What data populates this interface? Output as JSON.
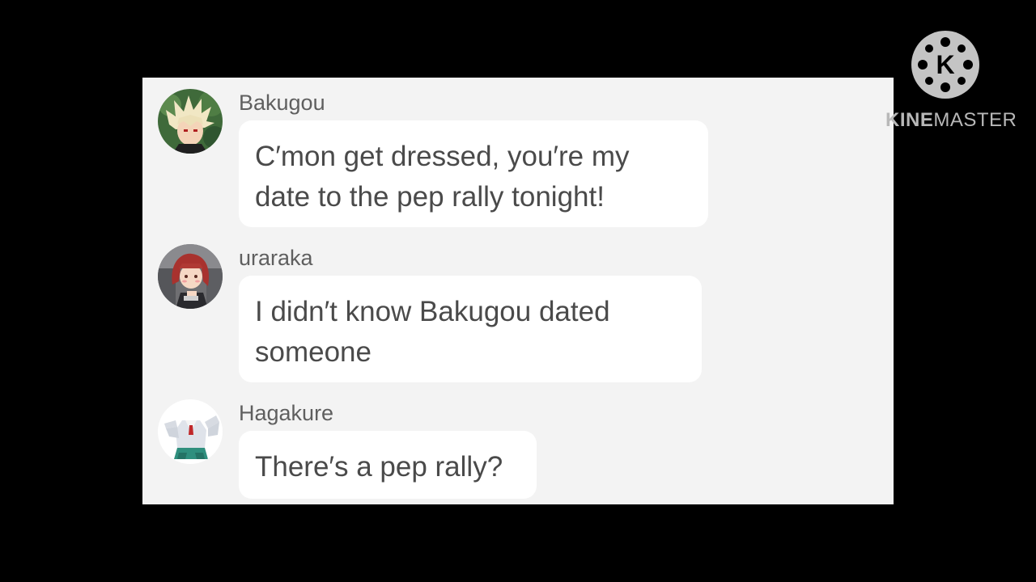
{
  "watermark": {
    "brand_part1": "KINE",
    "brand_part2": "MASTER",
    "logo_letter": "K",
    "icon": "kinemaster-logo-icon"
  },
  "chat": {
    "messages": [
      {
        "sender": "Bakugou",
        "avatar_icon": "bakugou-avatar-icon",
        "lines": [
          "C′mon get dressed, you′re my",
          "date to the pep rally tonight!"
        ]
      },
      {
        "sender": "uraraka",
        "avatar_icon": "uraraka-avatar-icon",
        "lines": [
          "I didn′t know Bakugou dated",
          "someone"
        ]
      },
      {
        "sender": "Hagakure",
        "avatar_icon": "hagakure-avatar-icon",
        "lines": [
          "There′s a pep rally?"
        ]
      }
    ]
  },
  "colors": {
    "background": "#000000",
    "panel": "#f3f3f3",
    "bubble": "#ffffff",
    "name_text": "#5f5f5f",
    "message_text": "#4a4a4a"
  }
}
